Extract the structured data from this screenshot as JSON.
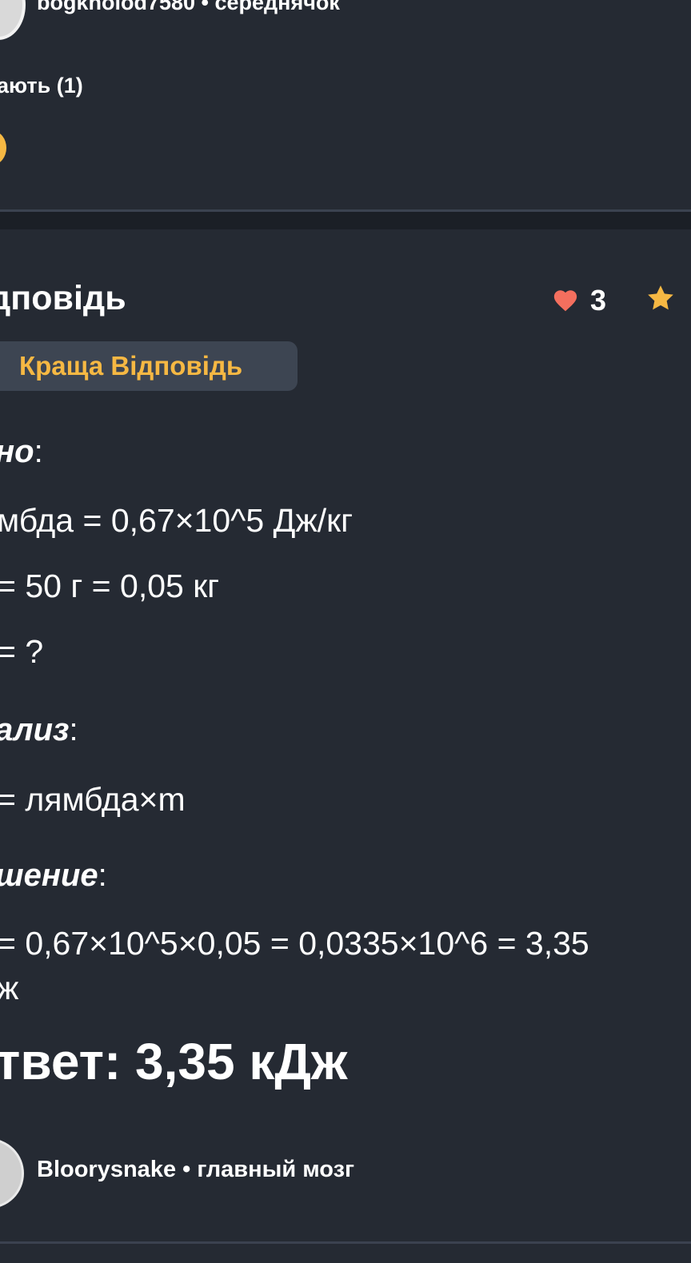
{
  "question_card": {
    "author_line": "bogkholod7580 • середнячок",
    "thanks_label": "ають (1)"
  },
  "answer": {
    "title": "дповідь",
    "likes": "3",
    "best_badge": "Краща Відповідь",
    "body": {
      "given_head": "но",
      "given_colon": ":",
      "given_1": "мбда = 0,67×10^5 Дж/кг",
      "given_2": "= 50 г = 0,05 кг",
      "given_3": "= ?",
      "analysis_head": "ализ",
      "analysis_colon": ":",
      "analysis_1": "= лямбда×m",
      "solution_head": "шение",
      "solution_colon": ":",
      "solution_1": "= 0,67×10^5×0,05 = 0,0335×10^6 = 3,35",
      "solution_2": "ж",
      "final": "твет: 3,35 кДж"
    },
    "author_line": "Bloorysnake • главный мозг"
  },
  "colors": {
    "background": "#252a33",
    "separator": "#1b1f26",
    "accent_yellow": "#f6b843",
    "heart_red": "#f46f5e",
    "badge_bg": "#3d4552"
  },
  "icons": {
    "heart": "heart-icon",
    "star": "star-icon"
  }
}
